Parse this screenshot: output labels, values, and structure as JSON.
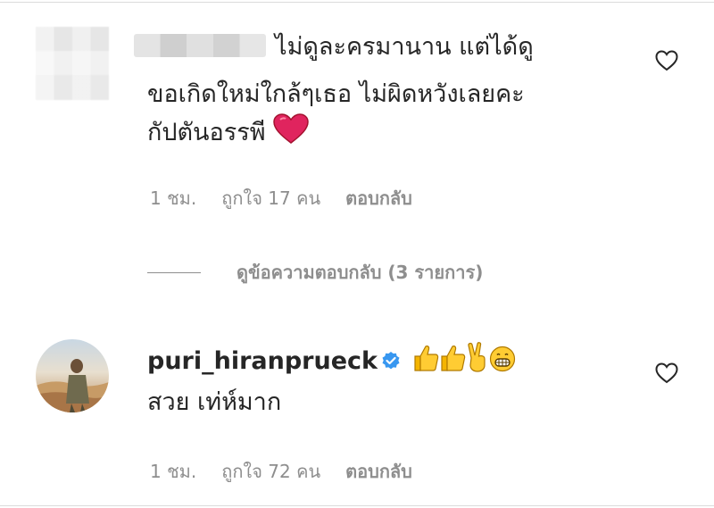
{
  "comments": [
    {
      "username": "",
      "text_line1": "ไม่ดูละครมานาน แต่ได้ดู",
      "text_line2": "ขอเกิดใหม่ใกล้ๆเธอ ไม่ผิดหวังเลยคะ",
      "text_line3": "กัปตันอรรพี",
      "emoji": "heart",
      "time": "1 ชม.",
      "likes": "ถูกใจ 17 คน",
      "reply": "ตอบกลับ"
    },
    {
      "username": "puri_hiranprueck",
      "verified": true,
      "emojis": [
        "thumbs-up",
        "thumbs-up",
        "victory-hand",
        "grinning-face"
      ],
      "text_line1": "สวย เท่ห์มาก",
      "time": "1 ชม.",
      "likes": "ถูกใจ 72 คน",
      "reply": "ตอบกลับ"
    }
  ],
  "view_replies": "ดูข้อความตอบกลับ (3 รายการ)",
  "colors": {
    "verified": "#3897f0",
    "heart": "#e0245e",
    "muted": "#8e8e8e",
    "text": "#262626"
  }
}
